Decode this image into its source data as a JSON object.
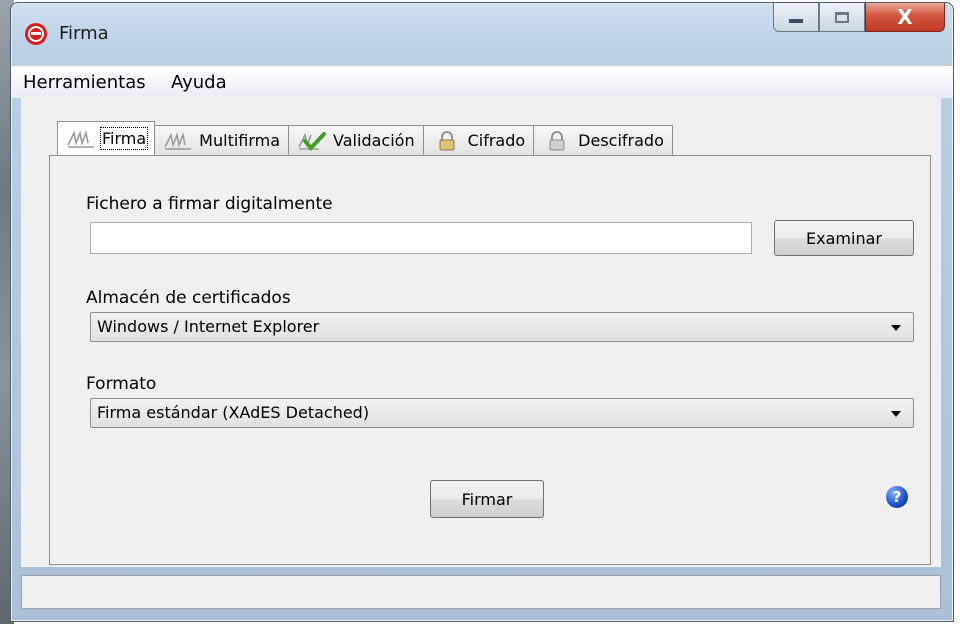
{
  "window": {
    "title": "Firma"
  },
  "title_buttons": {
    "minimize": "minimize",
    "maximize": "maximize",
    "close": "X"
  },
  "menu": {
    "items": [
      {
        "label": "Herramientas"
      },
      {
        "label": "Ayuda"
      }
    ]
  },
  "tabs": [
    {
      "label": "Firma",
      "icon": "signature-icon",
      "active": true
    },
    {
      "label": "Multifirma",
      "icon": "signature-icon",
      "active": false
    },
    {
      "label": "Validación",
      "icon": "validate-check-icon",
      "active": false
    },
    {
      "label": "Cifrado",
      "icon": "lock-open-icon",
      "active": false
    },
    {
      "label": "Descifrado",
      "icon": "lock-closed-icon",
      "active": false
    }
  ],
  "form": {
    "file_label": "Fichero a firmar digitalmente",
    "file_value": "",
    "browse_button": "Examinar",
    "store_label": "Almacén de certificados",
    "store_value": "Windows / Internet Explorer",
    "format_label": "Formato",
    "format_value": "Firma estándar (XAdES Detached)",
    "sign_button": "Firmar"
  },
  "help": {
    "glyph": "?"
  },
  "status": {
    "text": ""
  }
}
